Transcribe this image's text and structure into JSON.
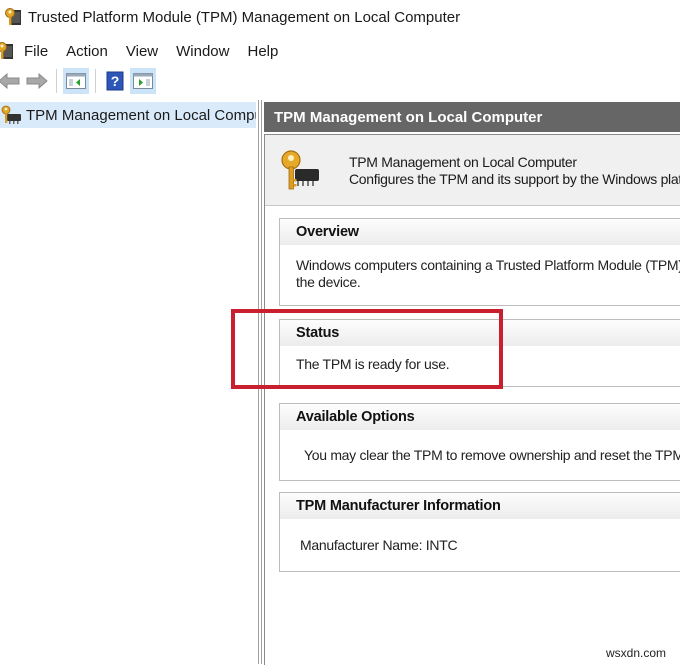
{
  "window": {
    "title": "Trusted Platform Module (TPM) Management on Local Computer"
  },
  "menubar": {
    "items": [
      "File",
      "Action",
      "View",
      "Window",
      "Help"
    ]
  },
  "toolbar": {
    "buttons": [
      {
        "name": "back",
        "icon": "back-arrow-icon"
      },
      {
        "name": "forward",
        "icon": "forward-arrow-icon"
      },
      {
        "name": "show-hide-console-tree",
        "icon": "console-tree-icon"
      },
      {
        "name": "help",
        "icon": "help-icon",
        "label": "?"
      },
      {
        "name": "show-hide-action-pane",
        "icon": "action-pane-icon"
      }
    ]
  },
  "tree": {
    "selected_item": "TPM Management on Local Compu"
  },
  "main": {
    "header": "TPM Management on Local Computer",
    "intro": {
      "title": "TPM Management on Local Computer",
      "description": "Configures the TPM and its support by the Windows platf"
    },
    "sections": [
      {
        "title": "Overview",
        "lines": [
          "Windows computers containing a Trusted Platform Module (TPM)",
          "the device."
        ]
      },
      {
        "title": "Status",
        "lines": [
          "The TPM is ready for use."
        ]
      },
      {
        "title": "Available Options",
        "lines": [
          "You may clear the TPM to remove ownership and reset the TPM"
        ]
      },
      {
        "title": "TPM Manufacturer Information",
        "lines": [
          "Manufacturer Name:  INTC"
        ]
      }
    ]
  },
  "annotation": {
    "highlight_color": "#c8202f",
    "target": "Status"
  },
  "watermark": "wsxdn.com"
}
